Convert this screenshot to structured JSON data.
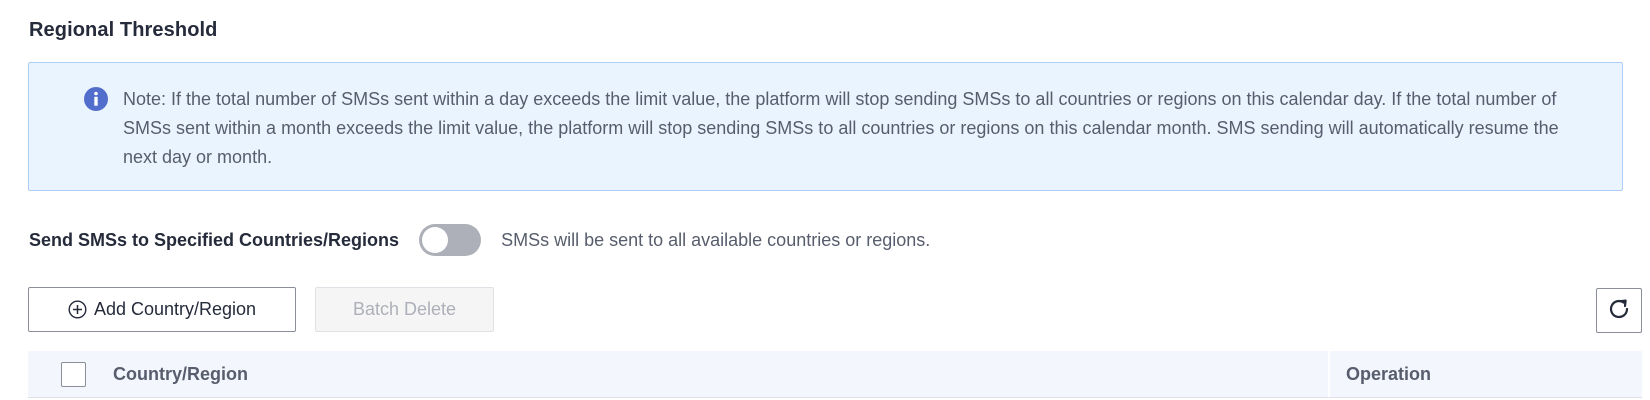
{
  "section": {
    "title": "Regional Threshold"
  },
  "note": {
    "icon": "info-icon",
    "text": "Note: If the total number of SMSs sent within a day exceeds the limit value, the platform will stop sending SMSs to all countries or regions on this calendar day. If the total number of SMSs sent within a month exceeds the limit value, the platform will stop sending SMSs to all countries or regions on this calendar month. SMS sending will automatically resume the next day or month."
  },
  "toggle": {
    "label": "Send SMSs to Specified Countries/Regions",
    "enabled": false,
    "description": "SMSs will be sent to all available countries or regions."
  },
  "toolbar": {
    "add_label": "Add Country/Region",
    "batch_delete_label": "Batch Delete",
    "batch_delete_disabled": true,
    "refresh_icon": "refresh-icon"
  },
  "table": {
    "columns": [
      "Country/Region",
      "Operation"
    ],
    "select_all_checked": false
  },
  "colors": {
    "info_blue": "#526ecc",
    "note_bg": "#eaf4ff",
    "note_border": "#adcff7",
    "toggle_off": "#adb0b8",
    "header_bg": "#f3f6fc"
  }
}
